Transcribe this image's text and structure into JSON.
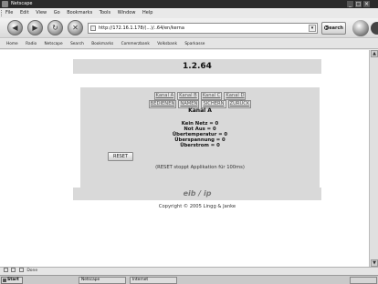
{
  "window": {
    "title": "Netscape"
  },
  "menu": [
    "File",
    "Edit",
    "View",
    "Go",
    "Bookmarks",
    "Tools",
    "Window",
    "Help"
  ],
  "nav": {
    "back_glyph": "◀",
    "forward_glyph": "▶",
    "reload_glyph": "↻",
    "stop_glyph": "✕",
    "url": "http://172.16.1.178/(...)/..64/en/kerna",
    "search_label": "Search"
  },
  "personal_toolbar": [
    "Home",
    "Radio",
    "Netscape",
    "Search",
    "Bookmarks",
    "Commerzbank",
    "Volksbank",
    "Sparkasse"
  ],
  "page": {
    "version": "1.2.64",
    "tabs_row1": [
      "Kanal A",
      "Kanal B",
      "Kanal C",
      "Kanal D"
    ],
    "tabs_row2": [
      "BEDIENEN",
      "NAMEN",
      "SICHERN",
      "ZURÜCK"
    ],
    "kanal_title": "Kanal A",
    "status_lines": [
      "Kein Netz = 0",
      "Not Aus = 0",
      "Übertemperatur = 0",
      "Überspannung = 0",
      "Überstrom = 0"
    ],
    "reset_label": "RESET",
    "reset_note": "(RESET stoppt Applikation für 100ms)",
    "brand": "eib / ip",
    "copyright": "Copyright © 2005 Lingg & Janke"
  },
  "statusbar": {
    "text": "Done"
  },
  "taskbar": {
    "start": "Start",
    "items": [
      "Netscape",
      "Internet"
    ],
    "clock": ""
  },
  "colors": {
    "panel": "#d9d9d9",
    "titlebar": "#2a2a2a",
    "page_bg": "#ffffff"
  }
}
